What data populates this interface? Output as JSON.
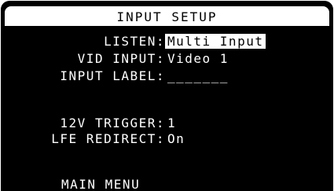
{
  "screen": {
    "title": "INPUT SETUP"
  },
  "settings": [
    {
      "label": "LISTEN:",
      "value": "Multi Input",
      "selected": true
    },
    {
      "label": "VID INPUT:",
      "value": "Video 1",
      "selected": false
    },
    {
      "label": "INPUT LABEL:",
      "value": "_______",
      "selected": false
    },
    {
      "label": "12V TRIGGER:",
      "value": "1",
      "selected": false
    },
    {
      "label": "LFE REDIRECT:",
      "value": "On",
      "selected": false
    }
  ],
  "footer": {
    "main_menu": "MAIN MENU"
  },
  "colors": {
    "background": "#000000",
    "text": "#ffffff",
    "highlight_bg": "#ffffff",
    "highlight_text": "#000000"
  }
}
